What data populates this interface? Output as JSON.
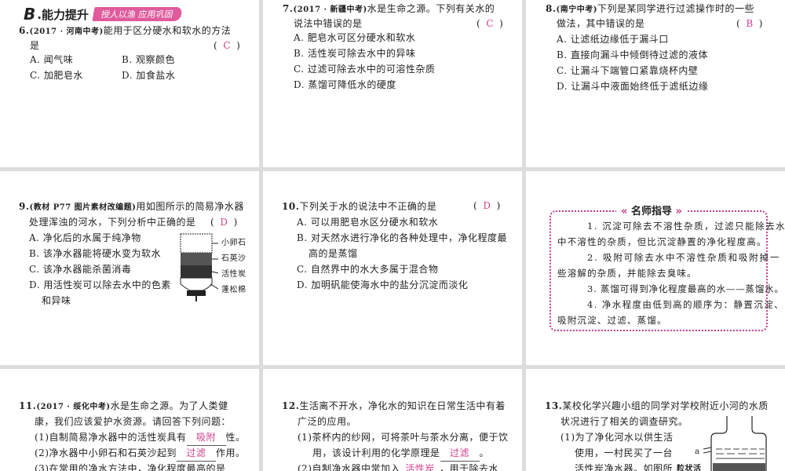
{
  "header": {
    "letter": "B",
    "title": ".能力提升",
    "tag": "授人以渔 应用巩固"
  },
  "q6": {
    "num": "6.",
    "source": "(2017 · 河南中考)",
    "stem1": "能用于区分硬水和软水的方法",
    "stem2": "是",
    "answer": "C",
    "options": [
      "A. 闻气味",
      "B. 观察颜色",
      "C. 加肥皂水",
      "D. 加食盐水"
    ]
  },
  "q7": {
    "num": "7.",
    "source": "(2017 · 新疆中考)",
    "stem1": "水是生命之源。下列有关水的",
    "stem2": "说法中错误的是",
    "answer": "C",
    "options": [
      "A. 肥皂水可区分硬水和软水",
      "B. 活性炭可除去水中的异味",
      "C. 过滤可除去水中的可溶性杂质",
      "D. 蒸馏可降低水的硬度"
    ]
  },
  "q8": {
    "num": "8.",
    "source": "(南宁中考)",
    "stem1": "下列是某同学进行过滤操作时的一些",
    "stem2": "做法，其中错误的是",
    "answer": "B",
    "options": [
      "A. 让滤纸边缘低于漏斗口",
      "B. 直接向漏斗中倾倒待过滤的液体",
      "C. 让漏斗下端管口紧靠烧杯内壁",
      "D. 让漏斗中液面始终低于滤纸边缘"
    ]
  },
  "q9": {
    "num": "9.",
    "source": "(教材 P77 图片素材改编题)",
    "stem1": "用如图所示的简易净水器",
    "stem2": "处理浑浊的河水，下列分析中正确的是",
    "answer": "D",
    "options": [
      "A. 净化后的水属于纯净物",
      "B. 该净水器能将硬水变为软水",
      "C. 该净水器能杀菌消毒",
      "D. 用活性炭可以除去水中的色素",
      "和异味"
    ],
    "figure_labels": [
      "小卵石",
      "石英沙",
      "活性炭",
      "蓬松棉"
    ]
  },
  "q10": {
    "num": "10.",
    "stem1": "下列关于水的说法中不正确的是",
    "answer": "D",
    "options": [
      "A. 可以用肥皂水区分硬水和软水",
      "B. 对天然水进行净化的各种处理中，净化程度最",
      "高的是蒸馏",
      "C. 自然界中的水大多属于混合物",
      "D. 加明矾能使海水中的盐分沉淀而淡化"
    ]
  },
  "tips": {
    "title": "名师指导",
    "lines": [
      "1. 沉淀可除去不溶性杂质，过滤只能除去水",
      "中不溶性的杂质，但比沉淀静置的净化程度高。",
      "2. 吸附可除去水中不溶性杂质和吸附掉一",
      "些溶解的杂质，并能除去臭味。",
      "3. 蒸馏可得到净化程度最高的水——蒸馏水。",
      "4. 净水程度由低到高的顺序为：静置沉淀、",
      "吸附沉淀、过滤、蒸馏。"
    ]
  },
  "q11": {
    "num": "11.",
    "source": "(2017 · 绥化中考)",
    "stem1": "水是生命之源。为了人类健",
    "stem2": "康，我们应该爱护水资源。请回答下列问题：",
    "p1a": "(1)自制简易净水器中的活性炭具有",
    "p1ans": "吸附",
    "p1b": "性。",
    "p2a": "(2)净水器中小卵石和石英沙起到",
    "p2ans": "过滤",
    "p2b": "作用。",
    "p3": "(3)在常用的净水方法中，净化程度最高的是"
  },
  "q12": {
    "num": "12.",
    "stem1": "生活离不开水，净化水的知识在日常生活中有着",
    "stem2": "广泛的应用。",
    "p1a": "(1)茶杯内的纱网，可将茶叶与茶水分离，便于饮",
    "p1b": "用，该设计利用的化学原理是",
    "p1ans": "过滤",
    "p1c": "。",
    "p2a": "(2)自制净水器中常加入",
    "p2ans": "活性炭",
    "p2b": "，用于除去水"
  },
  "q13": {
    "num": "13.",
    "stem1": "某校化学兴趣小组的同学对学校附近小河的水质",
    "stem2": "状况进行了相关的调查研究。",
    "p1": "(1)为了净化河水以供生活",
    "p2": "使用，一村民买了一台",
    "p3": "活性炭净水器。如图所",
    "fig_a": "a",
    "fig_label": "粒状活"
  }
}
